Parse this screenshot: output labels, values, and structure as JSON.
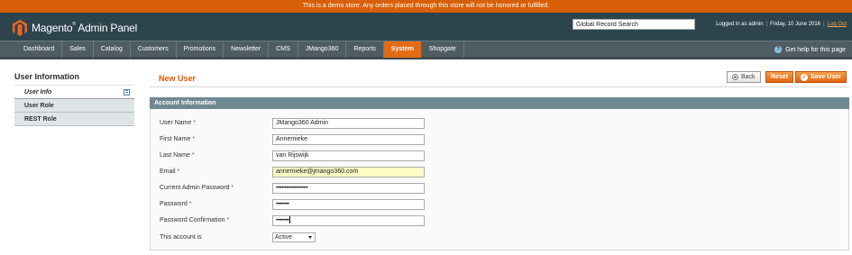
{
  "notice": "This is a demo store. Any orders placed through this store will not be honored or fulfilled.",
  "header": {
    "logo_text": "Magento",
    "logo_suffix": "Admin Panel",
    "search_value": "Global Record Search",
    "logged_in": "Logged in as admin",
    "date": "Friday, 10 June 2016",
    "logout": "Log Out"
  },
  "nav": {
    "items": [
      "Dashboard",
      "Sales",
      "Catalog",
      "Customers",
      "Promotions",
      "Newsletter",
      "CMS",
      "JMango360",
      "Reports",
      "System",
      "Shopgate"
    ],
    "active": "System",
    "help": "Get help for this page"
  },
  "sidebar": {
    "title": "User Information",
    "tabs": [
      "User Info",
      "User Role",
      "REST Role"
    ]
  },
  "page": {
    "title": "New User",
    "back": "Back",
    "reset": "Reset",
    "save": "Save User"
  },
  "form": {
    "section": "Account Information",
    "fields": [
      {
        "label": "User Name",
        "required": "*",
        "value": "JMango360 Admin"
      },
      {
        "label": "First Name",
        "required": "*",
        "value": "Annemieke"
      },
      {
        "label": "Last Name",
        "required": "*",
        "value": "van Rijswijk"
      },
      {
        "label": "Email",
        "required": "*",
        "value": "annemieke@jmango360.com"
      },
      {
        "label": "Current Admin Password",
        "required": "*",
        "value": "••••••••••••••••••••••"
      },
      {
        "label": "Password",
        "required": "*",
        "value": "•••••••••"
      },
      {
        "label": "Password Confirmation",
        "required": "*",
        "value": "•••••••••"
      }
    ],
    "status_label": "This account is",
    "status_value": "Active"
  },
  "colors": {
    "accent": "#e36b13",
    "header_bg": "#2d444f",
    "nav_bg": "#4f5d63",
    "notice_bg": "#d75f07",
    "section_head": "#6f8992"
  }
}
